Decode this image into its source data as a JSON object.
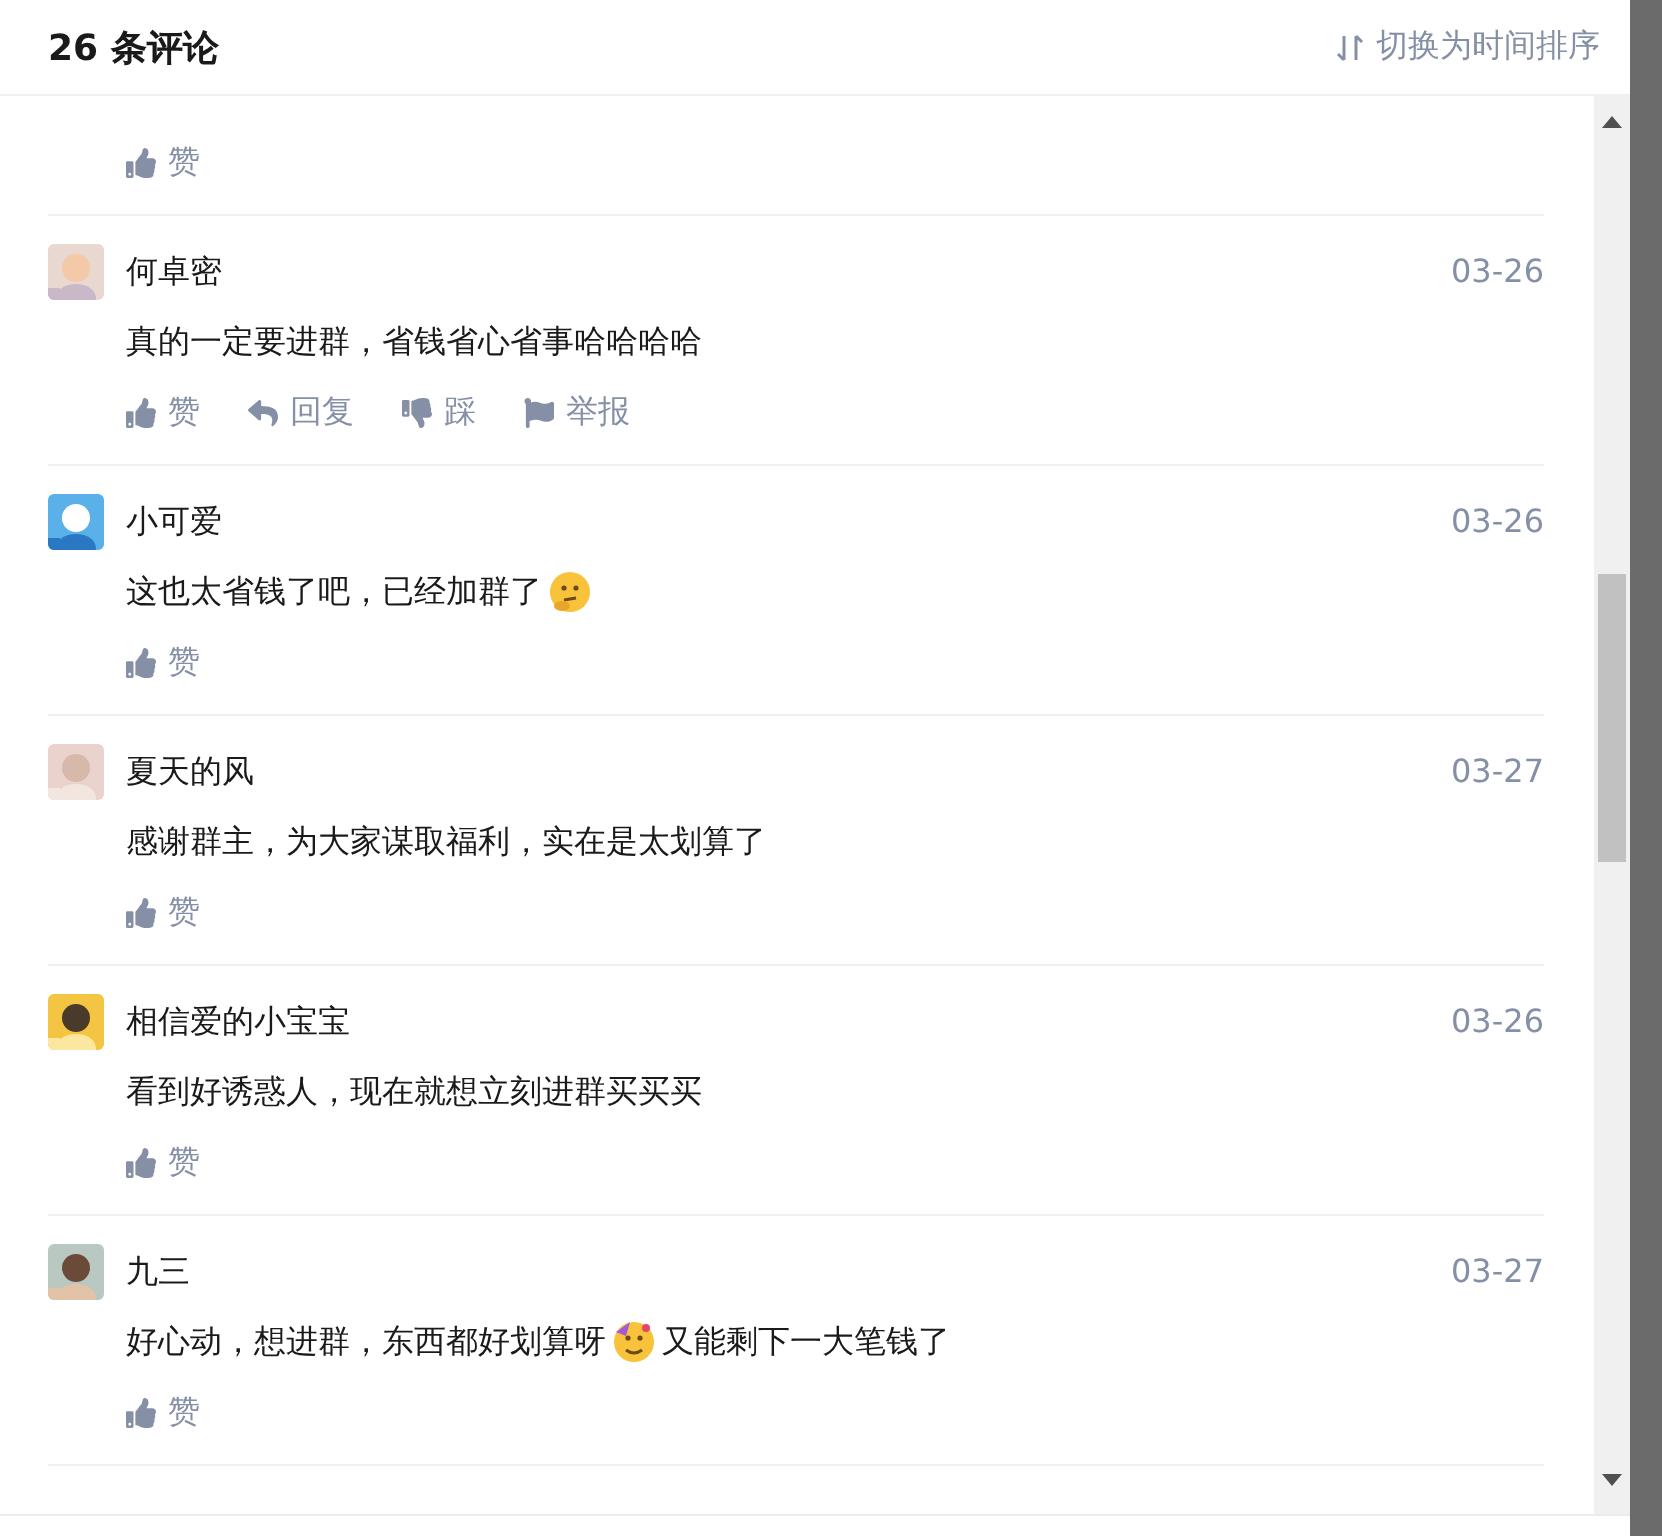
{
  "header": {
    "title": "26 条评论",
    "sort_button": "切换为时间排序"
  },
  "comments": [
    {
      "actions": [
        {
          "kind": "like",
          "label": "赞"
        }
      ]
    },
    {
      "user": "何卓密",
      "date": "03-26",
      "content": [
        {
          "kind": "text",
          "text": "真的一定要进群，省钱省心省事哈哈哈哈"
        }
      ],
      "actions": [
        {
          "kind": "like",
          "label": "赞"
        },
        {
          "kind": "reply",
          "label": "回复"
        },
        {
          "kind": "dislike",
          "label": "踩"
        },
        {
          "kind": "report",
          "label": "举报"
        }
      ]
    },
    {
      "user": "小可爱",
      "date": "03-26",
      "content": [
        {
          "kind": "text",
          "text": "这也太省钱了吧，已经加群了"
        },
        {
          "kind": "thinking"
        }
      ],
      "actions": [
        {
          "kind": "like",
          "label": "赞"
        }
      ]
    },
    {
      "user": "夏天的风",
      "date": "03-27",
      "content": [
        {
          "kind": "text",
          "text": "感谢群主，为大家谋取福利，实在是太划算了"
        }
      ],
      "actions": [
        {
          "kind": "like",
          "label": "赞"
        }
      ]
    },
    {
      "user": "相信爱的小宝宝",
      "date": "03-26",
      "content": [
        {
          "kind": "text",
          "text": "看到好诱惑人，现在就想立刻进群买买买"
        }
      ],
      "actions": [
        {
          "kind": "like",
          "label": "赞"
        }
      ]
    },
    {
      "user": "九三",
      "date": "03-27",
      "content": [
        {
          "kind": "text",
          "text": "好心动，想进群，东西都好划算呀"
        },
        {
          "kind": "party"
        },
        {
          "kind": "text",
          "text": "又能剩下一大笔钱了"
        }
      ],
      "actions": [
        {
          "kind": "like",
          "label": "赞"
        }
      ]
    }
  ]
}
